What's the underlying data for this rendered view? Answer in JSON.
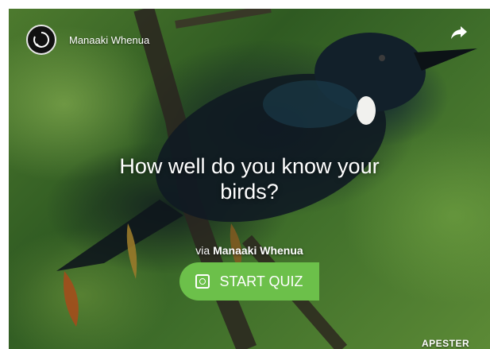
{
  "header": {
    "brand_name": "Manaaki Whenua",
    "logo_icon": "circular-refresh-logo-icon",
    "share_icon": "share-arrow-icon"
  },
  "quiz": {
    "title": "How well do you know your birds?",
    "via_prefix": "via",
    "via_source": "Manaaki Whenua",
    "start_label": "START QUIZ",
    "start_icon": "quiz-icon"
  },
  "footer": {
    "powered_by": "APESTER"
  },
  "colors": {
    "button_green": "#6cc04a",
    "text": "#ffffff"
  }
}
